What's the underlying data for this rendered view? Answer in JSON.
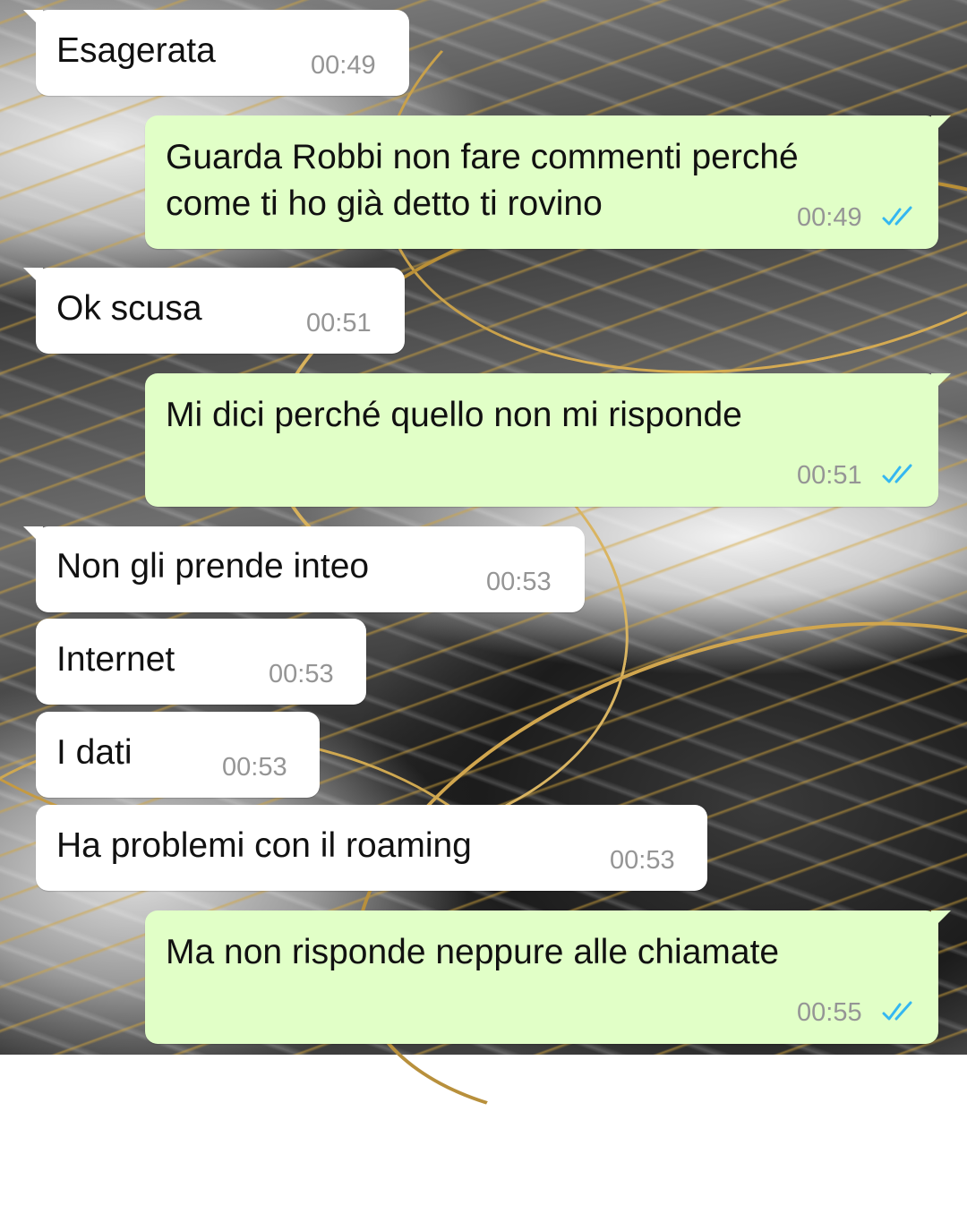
{
  "theme": {
    "incoming_bubble": "#ffffff",
    "outgoing_bubble": "#e1ffc7",
    "text_color": "#111111",
    "time_color": "#959595",
    "read_tick_color": "#34b7f1",
    "wallpaper": "black-white-gold marble"
  },
  "messages": [
    {
      "direction": "incoming",
      "text": "Esagerata",
      "time": "00:49"
    },
    {
      "direction": "outgoing",
      "text": "Guarda Robbi non fare commenti perché\ncome ti ho già detto ti rovino",
      "time": "00:49",
      "status_icon": "double-check-read-icon"
    },
    {
      "direction": "incoming",
      "text": "Ok scusa",
      "time": "00:51"
    },
    {
      "direction": "outgoing",
      "text": "Mi dici perché quello non mi risponde",
      "time": "00:51",
      "status_icon": "double-check-read-icon"
    },
    {
      "direction": "incoming",
      "text": "Non gli prende inteo",
      "time": "00:53"
    },
    {
      "direction": "incoming",
      "text": "Internet",
      "time": "00:53"
    },
    {
      "direction": "incoming",
      "text": "I dati",
      "time": "00:53"
    },
    {
      "direction": "incoming",
      "text": "Ha problemi con il roaming",
      "time": "00:53"
    },
    {
      "direction": "outgoing",
      "text": "Ma non risponde neppure alle chiamate",
      "time": "00:55",
      "status_icon": "double-check-read-icon"
    }
  ]
}
